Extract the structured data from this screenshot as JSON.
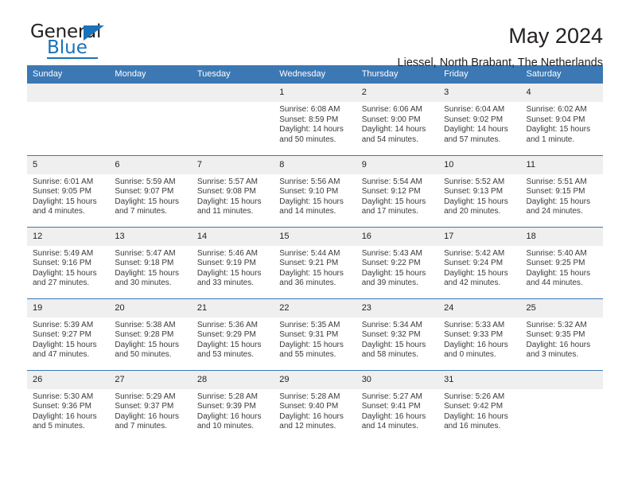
{
  "brand": {
    "name_top": "General",
    "name_bottom": "Blue",
    "accent_color": "#1b72b8"
  },
  "header": {
    "month_title": "May 2024",
    "location": "Liessel, North Brabant, The Netherlands"
  },
  "calendar": {
    "header_color": "#3c78b4",
    "daynum_bg": "#efefef",
    "weekday_headers": [
      "Sunday",
      "Monday",
      "Tuesday",
      "Wednesday",
      "Thursday",
      "Friday",
      "Saturday"
    ],
    "labels": {
      "sunrise": "Sunrise:",
      "sunset": "Sunset:",
      "daylight": "Daylight:"
    },
    "weeks": [
      [
        {
          "empty": true
        },
        {
          "empty": true
        },
        {
          "empty": true
        },
        {
          "day": "1",
          "sunrise": "Sunrise: 6:08 AM",
          "sunset": "Sunset: 8:59 PM",
          "daylight_1": "Daylight: 14 hours",
          "daylight_2": "and 50 minutes."
        },
        {
          "day": "2",
          "sunrise": "Sunrise: 6:06 AM",
          "sunset": "Sunset: 9:00 PM",
          "daylight_1": "Daylight: 14 hours",
          "daylight_2": "and 54 minutes."
        },
        {
          "day": "3",
          "sunrise": "Sunrise: 6:04 AM",
          "sunset": "Sunset: 9:02 PM",
          "daylight_1": "Daylight: 14 hours",
          "daylight_2": "and 57 minutes."
        },
        {
          "day": "4",
          "sunrise": "Sunrise: 6:02 AM",
          "sunset": "Sunset: 9:04 PM",
          "daylight_1": "Daylight: 15 hours",
          "daylight_2": "and 1 minute."
        }
      ],
      [
        {
          "day": "5",
          "sunrise": "Sunrise: 6:01 AM",
          "sunset": "Sunset: 9:05 PM",
          "daylight_1": "Daylight: 15 hours",
          "daylight_2": "and 4 minutes."
        },
        {
          "day": "6",
          "sunrise": "Sunrise: 5:59 AM",
          "sunset": "Sunset: 9:07 PM",
          "daylight_1": "Daylight: 15 hours",
          "daylight_2": "and 7 minutes."
        },
        {
          "day": "7",
          "sunrise": "Sunrise: 5:57 AM",
          "sunset": "Sunset: 9:08 PM",
          "daylight_1": "Daylight: 15 hours",
          "daylight_2": "and 11 minutes."
        },
        {
          "day": "8",
          "sunrise": "Sunrise: 5:56 AM",
          "sunset": "Sunset: 9:10 PM",
          "daylight_1": "Daylight: 15 hours",
          "daylight_2": "and 14 minutes."
        },
        {
          "day": "9",
          "sunrise": "Sunrise: 5:54 AM",
          "sunset": "Sunset: 9:12 PM",
          "daylight_1": "Daylight: 15 hours",
          "daylight_2": "and 17 minutes."
        },
        {
          "day": "10",
          "sunrise": "Sunrise: 5:52 AM",
          "sunset": "Sunset: 9:13 PM",
          "daylight_1": "Daylight: 15 hours",
          "daylight_2": "and 20 minutes."
        },
        {
          "day": "11",
          "sunrise": "Sunrise: 5:51 AM",
          "sunset": "Sunset: 9:15 PM",
          "daylight_1": "Daylight: 15 hours",
          "daylight_2": "and 24 minutes."
        }
      ],
      [
        {
          "day": "12",
          "sunrise": "Sunrise: 5:49 AM",
          "sunset": "Sunset: 9:16 PM",
          "daylight_1": "Daylight: 15 hours",
          "daylight_2": "and 27 minutes."
        },
        {
          "day": "13",
          "sunrise": "Sunrise: 5:47 AM",
          "sunset": "Sunset: 9:18 PM",
          "daylight_1": "Daylight: 15 hours",
          "daylight_2": "and 30 minutes."
        },
        {
          "day": "14",
          "sunrise": "Sunrise: 5:46 AM",
          "sunset": "Sunset: 9:19 PM",
          "daylight_1": "Daylight: 15 hours",
          "daylight_2": "and 33 minutes."
        },
        {
          "day": "15",
          "sunrise": "Sunrise: 5:44 AM",
          "sunset": "Sunset: 9:21 PM",
          "daylight_1": "Daylight: 15 hours",
          "daylight_2": "and 36 minutes."
        },
        {
          "day": "16",
          "sunrise": "Sunrise: 5:43 AM",
          "sunset": "Sunset: 9:22 PM",
          "daylight_1": "Daylight: 15 hours",
          "daylight_2": "and 39 minutes."
        },
        {
          "day": "17",
          "sunrise": "Sunrise: 5:42 AM",
          "sunset": "Sunset: 9:24 PM",
          "daylight_1": "Daylight: 15 hours",
          "daylight_2": "and 42 minutes."
        },
        {
          "day": "18",
          "sunrise": "Sunrise: 5:40 AM",
          "sunset": "Sunset: 9:25 PM",
          "daylight_1": "Daylight: 15 hours",
          "daylight_2": "and 44 minutes."
        }
      ],
      [
        {
          "day": "19",
          "sunrise": "Sunrise: 5:39 AM",
          "sunset": "Sunset: 9:27 PM",
          "daylight_1": "Daylight: 15 hours",
          "daylight_2": "and 47 minutes."
        },
        {
          "day": "20",
          "sunrise": "Sunrise: 5:38 AM",
          "sunset": "Sunset: 9:28 PM",
          "daylight_1": "Daylight: 15 hours",
          "daylight_2": "and 50 minutes."
        },
        {
          "day": "21",
          "sunrise": "Sunrise: 5:36 AM",
          "sunset": "Sunset: 9:29 PM",
          "daylight_1": "Daylight: 15 hours",
          "daylight_2": "and 53 minutes."
        },
        {
          "day": "22",
          "sunrise": "Sunrise: 5:35 AM",
          "sunset": "Sunset: 9:31 PM",
          "daylight_1": "Daylight: 15 hours",
          "daylight_2": "and 55 minutes."
        },
        {
          "day": "23",
          "sunrise": "Sunrise: 5:34 AM",
          "sunset": "Sunset: 9:32 PM",
          "daylight_1": "Daylight: 15 hours",
          "daylight_2": "and 58 minutes."
        },
        {
          "day": "24",
          "sunrise": "Sunrise: 5:33 AM",
          "sunset": "Sunset: 9:33 PM",
          "daylight_1": "Daylight: 16 hours",
          "daylight_2": "and 0 minutes."
        },
        {
          "day": "25",
          "sunrise": "Sunrise: 5:32 AM",
          "sunset": "Sunset: 9:35 PM",
          "daylight_1": "Daylight: 16 hours",
          "daylight_2": "and 3 minutes."
        }
      ],
      [
        {
          "day": "26",
          "sunrise": "Sunrise: 5:30 AM",
          "sunset": "Sunset: 9:36 PM",
          "daylight_1": "Daylight: 16 hours",
          "daylight_2": "and 5 minutes."
        },
        {
          "day": "27",
          "sunrise": "Sunrise: 5:29 AM",
          "sunset": "Sunset: 9:37 PM",
          "daylight_1": "Daylight: 16 hours",
          "daylight_2": "and 7 minutes."
        },
        {
          "day": "28",
          "sunrise": "Sunrise: 5:28 AM",
          "sunset": "Sunset: 9:39 PM",
          "daylight_1": "Daylight: 16 hours",
          "daylight_2": "and 10 minutes."
        },
        {
          "day": "29",
          "sunrise": "Sunrise: 5:28 AM",
          "sunset": "Sunset: 9:40 PM",
          "daylight_1": "Daylight: 16 hours",
          "daylight_2": "and 12 minutes."
        },
        {
          "day": "30",
          "sunrise": "Sunrise: 5:27 AM",
          "sunset": "Sunset: 9:41 PM",
          "daylight_1": "Daylight: 16 hours",
          "daylight_2": "and 14 minutes."
        },
        {
          "day": "31",
          "sunrise": "Sunrise: 5:26 AM",
          "sunset": "Sunset: 9:42 PM",
          "daylight_1": "Daylight: 16 hours",
          "daylight_2": "and 16 minutes."
        },
        {
          "empty": true
        }
      ]
    ]
  }
}
